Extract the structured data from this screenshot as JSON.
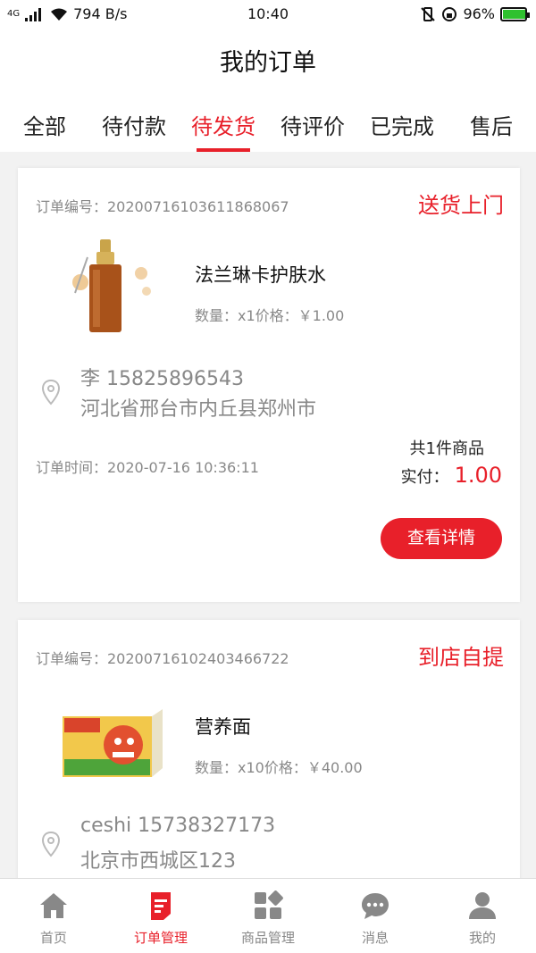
{
  "status_bar": {
    "network": "4G",
    "speed": "794 B/s",
    "time": "10:40",
    "battery": "96%",
    "battery_level": 0.96
  },
  "header": {
    "title": "我的订单"
  },
  "tabs": [
    {
      "label": "全部",
      "active": false
    },
    {
      "label": "待付款",
      "active": false
    },
    {
      "label": "待发货",
      "active": true
    },
    {
      "label": "待评价",
      "active": false
    },
    {
      "label": "已完成",
      "active": false
    },
    {
      "label": "售后",
      "active": false
    }
  ],
  "orders": [
    {
      "order_no": "订单编号：20200716103611868067",
      "delivery": "送货上门",
      "product_name": "法兰琳卡护肤水",
      "product_meta": "数量：x1价格：￥1.00",
      "contact": "李 15825896543",
      "address": "河北省邢台市内丘县郑州市",
      "order_time": "订单时间：2020-07-16 10:36:11",
      "item_count": "共1件商品",
      "paid_label": "实付：",
      "paid_amount": "1.00",
      "detail_button": "查看详情"
    },
    {
      "order_no": "订单编号：20200716102403466722",
      "delivery": "到店自提",
      "product_name": "营养面",
      "product_meta": "数量：x10价格：￥40.00",
      "contact": "ceshi 15738327173",
      "address": "北京市西城区123"
    }
  ],
  "bottom_nav": [
    {
      "label": "首页",
      "icon": "home-icon",
      "active": false
    },
    {
      "label": "订单管理",
      "icon": "order-icon",
      "active": true
    },
    {
      "label": "商品管理",
      "icon": "grid-icon",
      "active": false
    },
    {
      "label": "消息",
      "icon": "message-icon",
      "active": false
    },
    {
      "label": "我的",
      "icon": "user-icon",
      "active": false
    }
  ],
  "colors": {
    "accent": "#e8202a",
    "inactive": "#888888"
  }
}
